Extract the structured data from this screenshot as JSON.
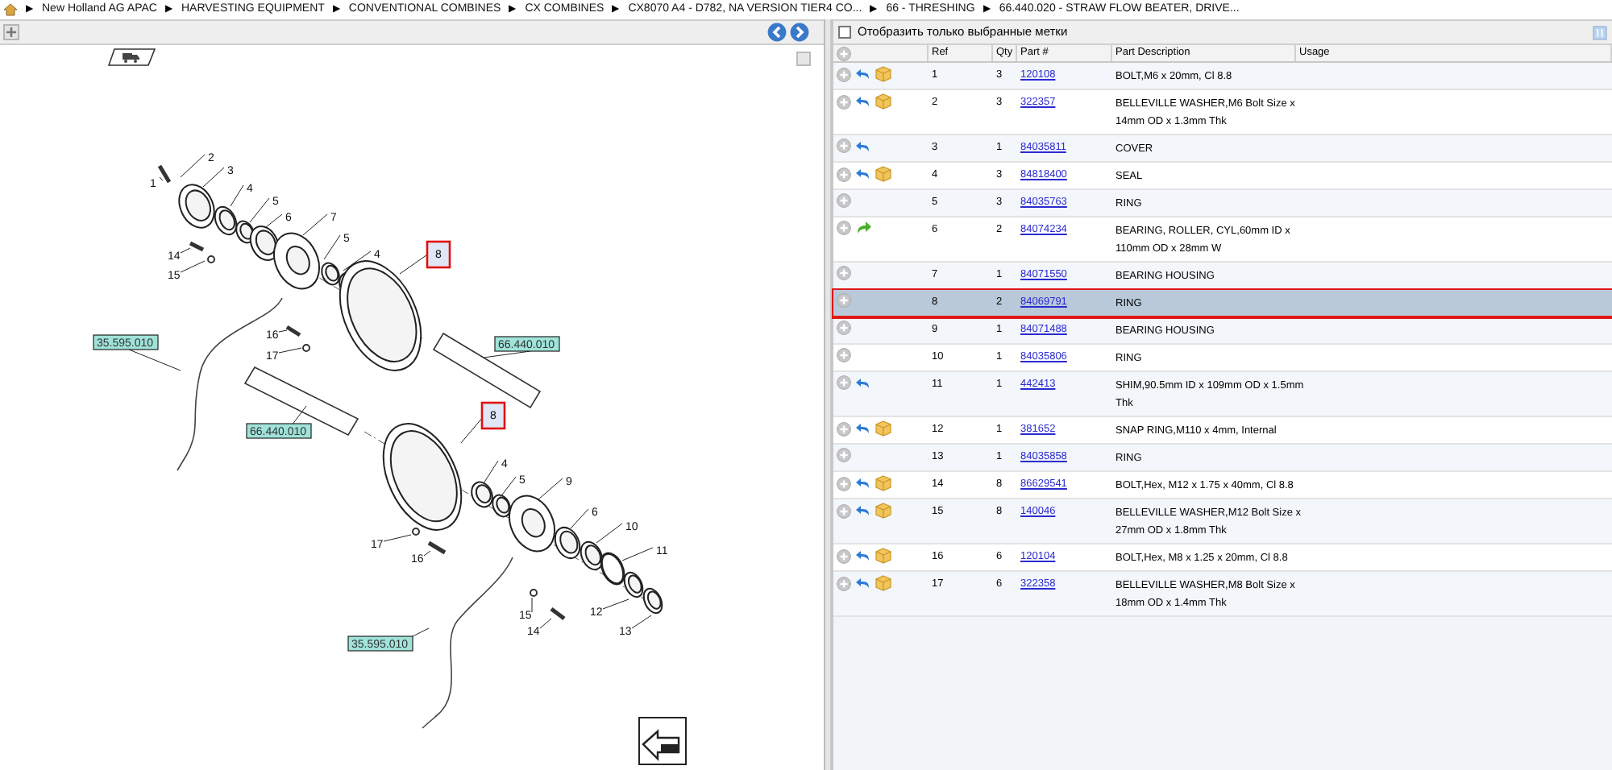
{
  "breadcrumb": {
    "separator": "▶",
    "items": [
      "New Holland AG APAC",
      "HARVESTING EQUIPMENT",
      "CONVENTIONAL COMBINES",
      "CX COMBINES",
      "CX8070 A4 - D782, NA VERSION TIER4 CO...",
      "66 - THRESHING",
      "66.440.020 - STRAW FLOW BEATER, DRIVE..."
    ]
  },
  "diagram": {
    "callouts": [
      {
        "text": "2",
        "highlighted": false
      },
      {
        "text": "3",
        "highlighted": false
      },
      {
        "text": "1",
        "highlighted": false
      },
      {
        "text": "4",
        "highlighted": false
      },
      {
        "text": "5",
        "highlighted": false
      },
      {
        "text": "6",
        "highlighted": false
      },
      {
        "text": "7",
        "highlighted": false
      },
      {
        "text": "5",
        "highlighted": false
      },
      {
        "text": "14",
        "highlighted": false
      },
      {
        "text": "4",
        "highlighted": false
      },
      {
        "text": "8",
        "highlighted": true
      },
      {
        "text": "15",
        "highlighted": false
      },
      {
        "text": "16",
        "highlighted": false
      },
      {
        "text": "17",
        "highlighted": false
      },
      {
        "text": "8",
        "highlighted": true
      },
      {
        "text": "4",
        "highlighted": false
      },
      {
        "text": "5",
        "highlighted": false
      },
      {
        "text": "9",
        "highlighted": false
      },
      {
        "text": "6",
        "highlighted": false
      },
      {
        "text": "10",
        "highlighted": false
      },
      {
        "text": "17",
        "highlighted": false
      },
      {
        "text": "11",
        "highlighted": false
      },
      {
        "text": "16",
        "highlighted": false
      },
      {
        "text": "15",
        "highlighted": false
      },
      {
        "text": "12",
        "highlighted": false
      },
      {
        "text": "14",
        "highlighted": false
      },
      {
        "text": "13",
        "highlighted": false
      }
    ],
    "reference_labels": [
      "35.595.010",
      "66.440.010",
      "66.440.010",
      "35.595.010"
    ]
  },
  "filter": {
    "label": "Отобразить только выбранные метки",
    "checked": false
  },
  "table": {
    "columns": [
      "Ref",
      "Qty",
      "Part #",
      "Part Description",
      "Usage"
    ],
    "rows": [
      {
        "back_arrow": true,
        "forward_arrow": false,
        "package": true,
        "ref": "1",
        "qty": "3",
        "part": "120108",
        "description": "BOLT,M6 x 20mm, Cl 8.8",
        "selected": false
      },
      {
        "back_arrow": true,
        "forward_arrow": false,
        "package": true,
        "ref": "2",
        "qty": "3",
        "part": "322357",
        "description": "BELLEVILLE WASHER,M6 Bolt Size x 14mm OD x 1.3mm Thk",
        "selected": false
      },
      {
        "back_arrow": true,
        "forward_arrow": false,
        "package": false,
        "ref": "3",
        "qty": "1",
        "part": "84035811",
        "description": "COVER",
        "selected": false
      },
      {
        "back_arrow": true,
        "forward_arrow": false,
        "package": true,
        "ref": "4",
        "qty": "3",
        "part": "84818400",
        "description": "SEAL",
        "selected": false
      },
      {
        "back_arrow": false,
        "forward_arrow": false,
        "package": false,
        "ref": "5",
        "qty": "3",
        "part": "84035763",
        "description": "RING",
        "selected": false
      },
      {
        "back_arrow": false,
        "forward_arrow": true,
        "package": false,
        "ref": "6",
        "qty": "2",
        "part": "84074234",
        "description": "BEARING, ROLLER, CYL,60mm ID x 110mm OD x 28mm W",
        "selected": false
      },
      {
        "back_arrow": false,
        "forward_arrow": false,
        "package": false,
        "ref": "7",
        "qty": "1",
        "part": "84071550",
        "description": "BEARING HOUSING",
        "selected": false
      },
      {
        "back_arrow": false,
        "forward_arrow": false,
        "package": false,
        "ref": "8",
        "qty": "2",
        "part": "84069791",
        "description": "RING",
        "selected": true
      },
      {
        "back_arrow": false,
        "forward_arrow": false,
        "package": false,
        "ref": "9",
        "qty": "1",
        "part": "84071488",
        "description": "BEARING HOUSING",
        "selected": false
      },
      {
        "back_arrow": false,
        "forward_arrow": false,
        "package": false,
        "ref": "10",
        "qty": "1",
        "part": "84035806",
        "description": "RING",
        "selected": false
      },
      {
        "back_arrow": true,
        "forward_arrow": false,
        "package": false,
        "ref": "11",
        "qty": "1",
        "part": "442413",
        "description": "SHIM,90.5mm ID x 109mm OD x 1.5mm Thk",
        "selected": false
      },
      {
        "back_arrow": true,
        "forward_arrow": false,
        "package": true,
        "ref": "12",
        "qty": "1",
        "part": "381652",
        "description": "SNAP RING,M110 x 4mm, Internal",
        "selected": false
      },
      {
        "back_arrow": false,
        "forward_arrow": false,
        "package": false,
        "ref": "13",
        "qty": "1",
        "part": "84035858",
        "description": "RING",
        "selected": false
      },
      {
        "back_arrow": true,
        "forward_arrow": false,
        "package": true,
        "ref": "14",
        "qty": "8",
        "part": "86629541",
        "description": "BOLT,Hex, M12 x 1.75 x 40mm, Cl 8.8",
        "selected": false
      },
      {
        "back_arrow": true,
        "forward_arrow": false,
        "package": true,
        "ref": "15",
        "qty": "8",
        "part": "140046",
        "description": "BELLEVILLE WASHER,M12 Bolt Size x 27mm OD x 1.8mm Thk",
        "selected": false
      },
      {
        "back_arrow": true,
        "forward_arrow": false,
        "package": true,
        "ref": "16",
        "qty": "6",
        "part": "120104",
        "description": "BOLT,Hex, M8 x 1.25 x 20mm, Cl 8.8",
        "selected": false
      },
      {
        "back_arrow": true,
        "forward_arrow": false,
        "package": true,
        "ref": "17",
        "qty": "6",
        "part": "322358",
        "description": "BELLEVILLE WASHER,M8 Bolt Size x 18mm OD x 1.4mm Thk",
        "selected": false
      }
    ]
  }
}
